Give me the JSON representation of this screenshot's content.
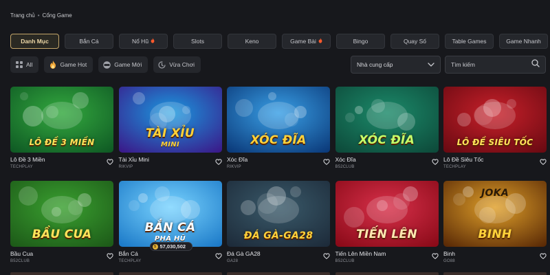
{
  "breadcrumb": {
    "home": "Trang chủ",
    "separator": "•",
    "current": "Cổng Game"
  },
  "categories": [
    {
      "label": "Danh Mục",
      "active": true,
      "hot": false
    },
    {
      "label": "Bắn Cá",
      "active": false,
      "hot": false
    },
    {
      "label": "Nổ Hũ",
      "active": false,
      "hot": true
    },
    {
      "label": "Slots",
      "active": false,
      "hot": false
    },
    {
      "label": "Keno",
      "active": false,
      "hot": false
    },
    {
      "label": "Game Bài",
      "active": false,
      "hot": true
    },
    {
      "label": "Bingo",
      "active": false,
      "hot": false
    },
    {
      "label": "Quay Số",
      "active": false,
      "hot": false
    },
    {
      "label": "Table Games",
      "active": false,
      "hot": false
    },
    {
      "label": "Game Nhanh",
      "active": false,
      "hot": false
    }
  ],
  "filters": [
    {
      "label": "All",
      "icon": "grid-icon"
    },
    {
      "label": "Game Hot",
      "icon": "flame-icon"
    },
    {
      "label": "Game Mới",
      "icon": "new-badge-icon"
    },
    {
      "label": "Vừa Chơi",
      "icon": "recent-icon"
    }
  ],
  "provider_select": {
    "label": "Nhà cung cấp"
  },
  "search": {
    "placeholder": "Tìm kiếm"
  },
  "colors": {
    "accent": "#c3a56a",
    "background": "#17181c",
    "card_bg": "#25272c"
  },
  "games": [
    {
      "name": "Lô Đề 3 Miền",
      "provider": "TECHPLAY",
      "art_text": "LÔ ĐỀ 3 MIỀN",
      "bg": [
        "#0f5a24",
        "#34a93f"
      ],
      "text_color": "#ffe45a"
    },
    {
      "name": "Tài Xỉu Mini",
      "provider": "RIKVIP",
      "art_text": "TÀI XỈU",
      "art_sub": "MINI",
      "bg": [
        "#3a1a8a",
        "#1a9adf"
      ],
      "text_color": "#ffd23a"
    },
    {
      "name": "Xóc Đĩa",
      "provider": "RIKVIP",
      "art_text": "XÓC ĐĨA",
      "bg": [
        "#0b3a7a",
        "#3aa0e6"
      ],
      "text_color": "#ffd23a"
    },
    {
      "name": "Xóc Đĩa",
      "provider": "B52CLUB",
      "art_text": "XÓC ĐĨA",
      "bg": [
        "#0d4a3a",
        "#1c8a6a"
      ],
      "text_color": "#c6ff6a"
    },
    {
      "name": "Lô Đề Siêu Tốc",
      "provider": "TECHPLAY",
      "art_text": "LÔ ĐỀ SIÊU TỐC",
      "bg": [
        "#6a0a12",
        "#c8202a"
      ],
      "text_color": "#ffe45a"
    },
    {
      "name": "Bầu Cua",
      "provider": "B52CLUB",
      "art_text": "BẦU CUA",
      "bg": [
        "#1d5a18",
        "#3aa030"
      ],
      "text_color": "#ffe45a"
    },
    {
      "name": "Bắn Cá",
      "provider": "TECHPLAY",
      "art_text": "BẮN CÁ",
      "art_sub": "PHÁ HŨ",
      "bg": [
        "#1c7ac8",
        "#7ad4ff"
      ],
      "text_color": "#ffffff",
      "jackpot": "57,030,502"
    },
    {
      "name": "Đá Gà GA28",
      "provider": "GA28",
      "art_text": "ĐÁ GÀ-GA28",
      "bg": [
        "#1d2b3a",
        "#3a5a6a"
      ],
      "text_color": "#ffd23a"
    },
    {
      "name": "Tiến Lên Miền Nam",
      "provider": "B52CLUB",
      "art_text": "TIẾN LÊN",
      "bg": [
        "#8a0a18",
        "#d8304a"
      ],
      "text_color": "#ffe8b0"
    },
    {
      "name": "Binh",
      "provider": "GO88",
      "art_text": "BINH",
      "art_top": "JOKA",
      "bg": [
        "#5a2a06",
        "#e0a02a"
      ],
      "text_color": "#ffd23a"
    }
  ]
}
